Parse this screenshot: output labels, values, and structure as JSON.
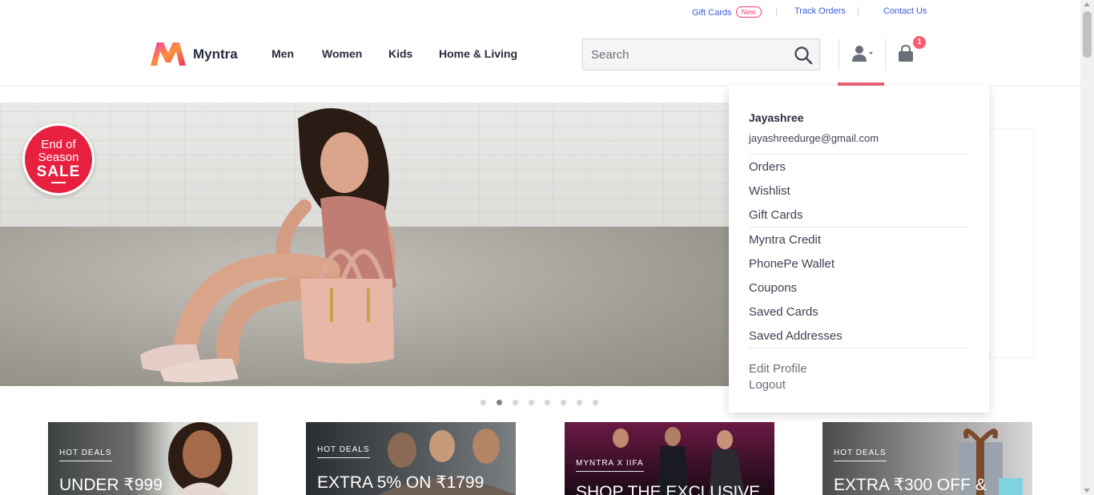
{
  "util_bar": {
    "gift_cards": "Gift Cards",
    "new_badge": "New",
    "track_orders": "Track Orders",
    "contact_us": "Contact Us",
    "separator": "|"
  },
  "header": {
    "brand": "Myntra",
    "nav": [
      "Men",
      "Women",
      "Kids",
      "Home & Living"
    ],
    "search_placeholder": "Search",
    "bag_count": "1"
  },
  "hero": {
    "badge_line1": "End of",
    "badge_line2": "Season",
    "badge_line3": "SALE",
    "slide_count": 8,
    "active_slide": 2
  },
  "cards": [
    {
      "tag": "HOT DEALS",
      "headline": "UNDER ₹999"
    },
    {
      "tag": "HOT DEALS",
      "headline": "EXTRA 5% ON ₹1799"
    },
    {
      "tag": "MYNTRA X IIFA",
      "headline": "SHOP THE EXCLUSIVE"
    },
    {
      "tag": "HOT DEALS",
      "headline": "EXTRA ₹300 OFF &"
    }
  ],
  "profile_menu": {
    "name": "Jayashree",
    "email": "jayashreedurge@gmail.com",
    "group1": [
      "Orders",
      "Wishlist",
      "Gift Cards"
    ],
    "group2": [
      "Myntra Credit",
      "PhonePe Wallet",
      "Coupons",
      "Saved Cards",
      "Saved Addresses"
    ],
    "edit_profile": "Edit Profile",
    "logout": "Logout"
  },
  "colors": {
    "accent": "#ff3f6c",
    "link": "#3b5bdb",
    "active_underline": "#ee5f73",
    "sale_red": "#e8203f"
  }
}
